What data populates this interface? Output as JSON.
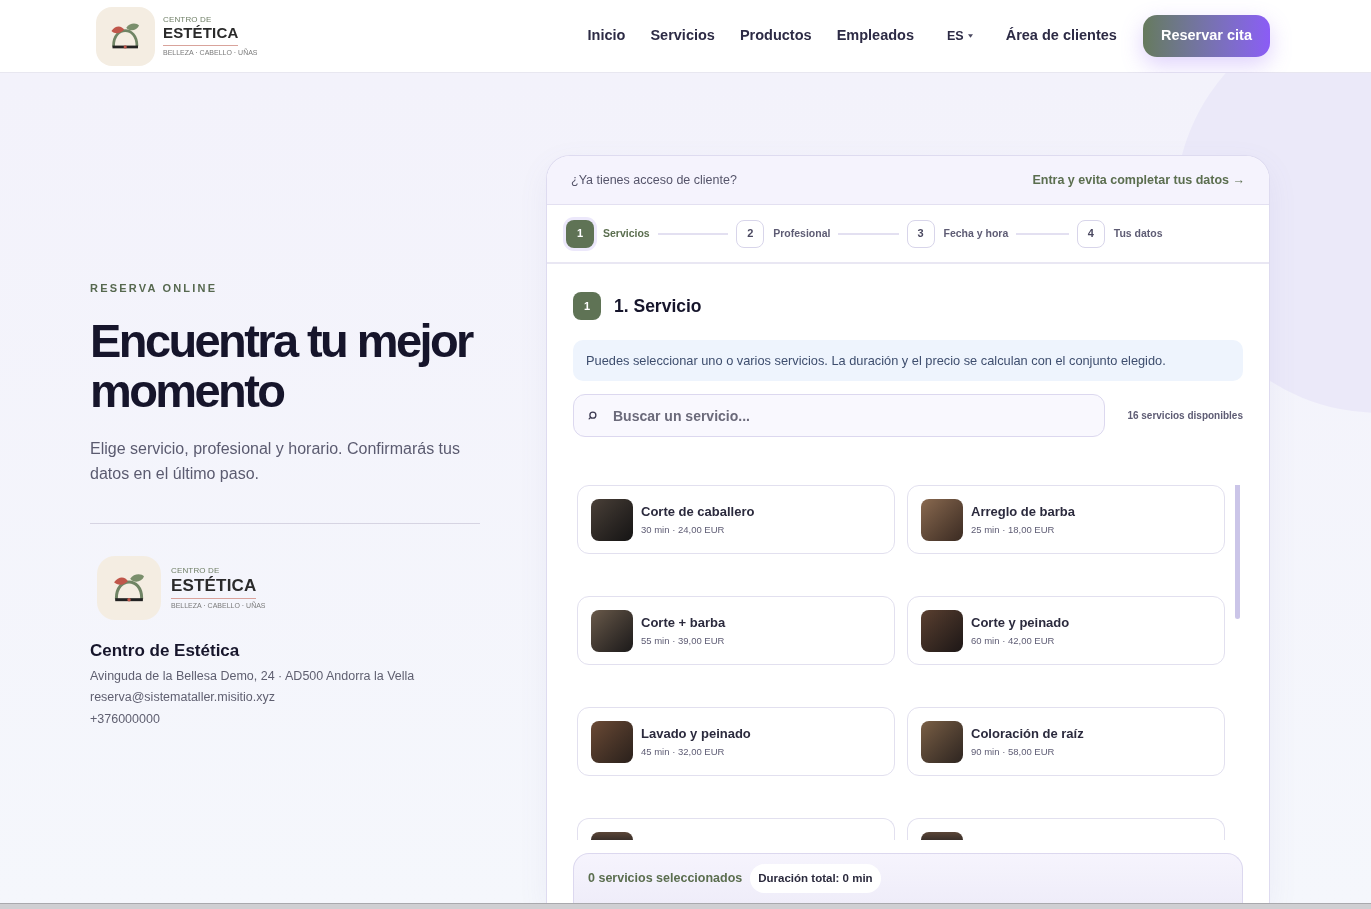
{
  "header": {
    "logo": {
      "caption": "CENTRO DE",
      "wordmark": "ESTÉTICA",
      "tagline": "BELLEZA · CABELLO · UÑAS"
    },
    "nav": [
      {
        "label": "Inicio",
        "kind": "link"
      },
      {
        "label": "Servicios",
        "kind": "link"
      },
      {
        "label": "Productos",
        "kind": "link"
      },
      {
        "label": "Empleados",
        "kind": "link"
      },
      {
        "label": "ES",
        "kind": "language"
      },
      {
        "label": "Área de clientes",
        "kind": "link"
      }
    ],
    "cta": {
      "label": "Reservar cita"
    }
  },
  "hero": {
    "eyebrow": "RESERVA ONLINE",
    "title": "Encuentra tu mejor momento",
    "subtitle": "Elige servicio, profesional y horario. Confirmarás tus datos en el último paso.",
    "logo": {
      "caption": "CENTRO DE",
      "wordmark": "ESTÉTICA",
      "tagline": "BELLEZA · CABELLO · UÑAS"
    },
    "business": {
      "name": "Centro de Estética",
      "address": "Avinguda de la Bellesa Demo, 24 · AD500 Andorra la Vella",
      "email": "reserva@sistemataller.misitio.xyz",
      "phone": "+376000000"
    }
  },
  "booking": {
    "login_prompt": "¿Ya tienes acceso de cliente?",
    "login_link": "Entra y evita completar tus datos →",
    "steps": [
      {
        "number": "1",
        "label": "Servicios",
        "selected": true
      },
      {
        "number": "2",
        "label": "Profesional",
        "selected": false
      },
      {
        "number": "3",
        "label": "Fecha y hora",
        "selected": false
      },
      {
        "number": "4",
        "label": "Tus datos",
        "selected": false
      }
    ],
    "section": {
      "number": "1",
      "title": "1. Servicio"
    },
    "info": "Puedes seleccionar uno o varios servicios. La duración y el precio se calculan con el conjunto elegido.",
    "search": {
      "placeholder": "Buscar un servicio..."
    },
    "available": "16 servicios disponibles",
    "services": [
      {
        "kind": "full",
        "name": "Corte de caballero",
        "meta": "30 min · 24,00 EUR",
        "selected": false
      },
      {
        "kind": "full",
        "name": "Arreglo de barba",
        "meta": "25 min · 18,00 EUR",
        "selected": false
      },
      {
        "kind": "full",
        "name": "Corte + barba",
        "meta": "55 min · 39,00 EUR",
        "selected": false
      },
      {
        "kind": "full",
        "name": "Corte y peinado",
        "meta": "60 min · 42,00 EUR",
        "selected": false
      },
      {
        "kind": "full",
        "name": "Lavado y peinado",
        "meta": "45 min · 32,00 EUR",
        "selected": false
      },
      {
        "kind": "full",
        "name": "Coloración de raíz",
        "meta": "90 min · 58,00 EUR",
        "selected": false
      },
      {
        "kind": "clipped",
        "selected": false
      },
      {
        "kind": "clipped",
        "selected": false
      }
    ],
    "summary": {
      "selected_count": "0 servicios seleccionados",
      "total": "Duración total: 0 min"
    }
  }
}
